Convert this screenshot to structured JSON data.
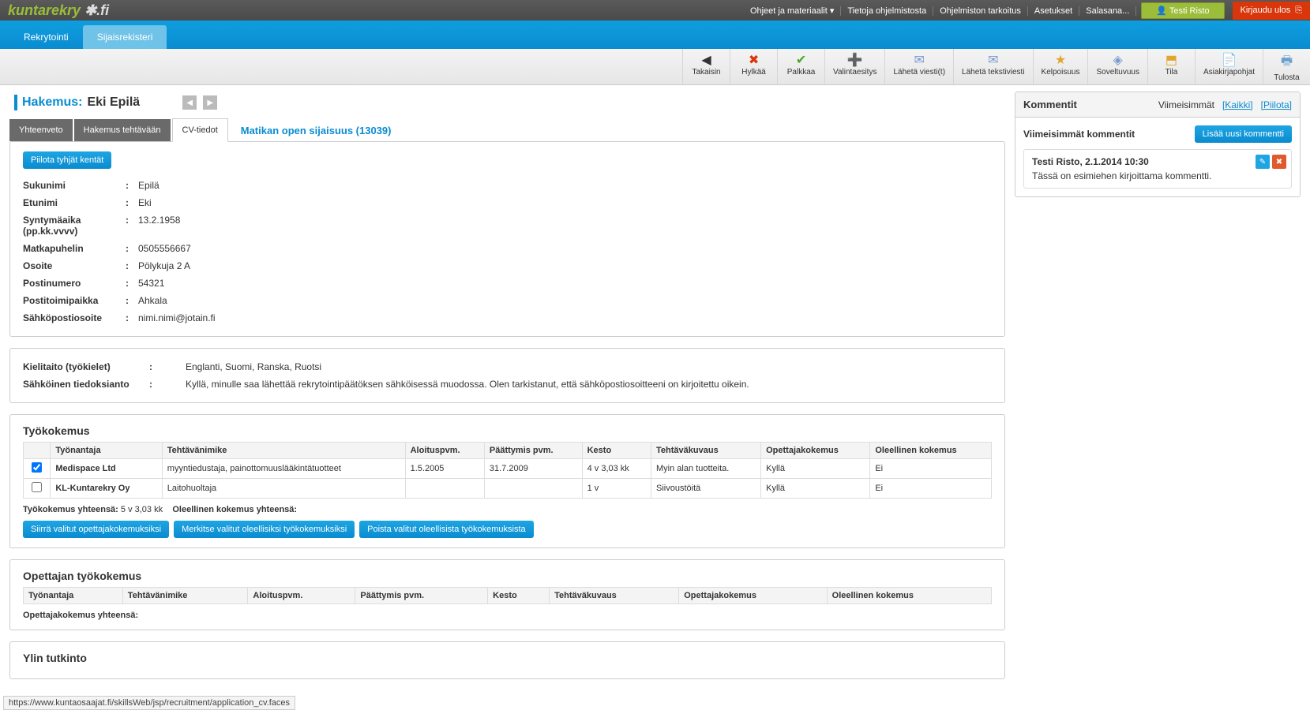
{
  "topbar": {
    "links": [
      "Ohjeet ja materiaalit ▾",
      "Tietoja ohjelmistosta",
      "Ohjelmiston tarkoitus",
      "Asetukset",
      "Salasana..."
    ],
    "user": "Testi Risto",
    "logout": "Kirjaudu ulos"
  },
  "nav": {
    "t1": "Rekrytointi",
    "t2": "Sijaisrekisteri"
  },
  "tools": [
    {
      "icon": "◀",
      "label": "Takaisin"
    },
    {
      "icon": "✖",
      "label": "Hylkää",
      "color": "#d9360b"
    },
    {
      "icon": "✔",
      "label": "Palkkaa",
      "color": "#4aa72a"
    },
    {
      "icon": "➕",
      "label": "Valintaesitys",
      "color": "#4aa72a"
    },
    {
      "icon": "✉",
      "label": "Lähetä viesti(t)",
      "color": "#7a9ad0"
    },
    {
      "icon": "✉",
      "label": "Lähetä tekstiviesti",
      "color": "#7a9ad0"
    },
    {
      "icon": "★",
      "label": "Kelpoisuus",
      "color": "#e0a62e"
    },
    {
      "icon": "◈",
      "label": "Soveltuvuus",
      "color": "#7a9ad0"
    },
    {
      "icon": "⬒",
      "label": "Tila",
      "color": "#e0a62e"
    },
    {
      "icon": "📄",
      "label": "Asiakirjapohjat",
      "color": "#7a9ad0"
    },
    {
      "icon": "🖶",
      "label": "Tulosta",
      "color": "#6aa0d0"
    }
  ],
  "heading": {
    "label": "Hakemus:",
    "value": "Eki Epilä"
  },
  "ctabs": {
    "t1": "Yhteenveto",
    "t2": "Hakemus tehtävään",
    "t3": "CV-tiedot",
    "link": "Matikan open sijaisuus (13039)"
  },
  "hideBtn": "Piilota tyhjät kentät",
  "personal": [
    {
      "k": "Sukunimi",
      "v": "Epilä"
    },
    {
      "k": "Etunimi",
      "v": "Eki"
    },
    {
      "k": "Syntymäaika (pp.kk.vvvv)",
      "v": "13.2.1958"
    },
    {
      "k": "Matkapuhelin",
      "v": "0505556667"
    },
    {
      "k": "Osoite",
      "v": "Pölykuja 2 A"
    },
    {
      "k": "Postinumero",
      "v": "54321"
    },
    {
      "k": "Postitoimipaikka",
      "v": "Ahkala"
    },
    {
      "k": "Sähköpostiosoite",
      "v": "nimi.nimi@jotain.fi"
    }
  ],
  "extra": [
    {
      "k": "Kielitaito (työkielet)",
      "v": "Englanti, Suomi, Ranska, Ruotsi"
    },
    {
      "k": "Sähköinen tiedoksianto",
      "v": "Kyllä, minulle saa lähettää rekrytointipäätöksen sähköisessä muodossa. Olen tarkistanut, että sähköpostiosoitteeni on kirjoitettu oikein."
    }
  ],
  "work": {
    "title": "Työkokemus",
    "headers": [
      "",
      "Työnantaja",
      "Tehtävänimike",
      "Aloituspvm.",
      "Päättymis pvm.",
      "Kesto",
      "Tehtäväkuvaus",
      "Opettajakokemus",
      "Oleellinen kokemus"
    ],
    "rows": [
      {
        "chk": true,
        "c": [
          "Medispace Ltd",
          "myyntiedustaja, painottomuuslääkintätuotteet",
          "1.5.2005",
          "31.7.2009",
          "4 v 3,03 kk",
          "Myin alan tuotteita.",
          "Kyllä",
          "Ei"
        ]
      },
      {
        "chk": false,
        "c": [
          "KL-Kuntarekry Oy",
          "Laitohuoltaja",
          "",
          "",
          "1 v",
          "Siivoustöitä",
          "Kyllä",
          "Ei"
        ]
      }
    ],
    "sum1_label": "Työkokemus yhteensä:",
    "sum1_val": "5 v 3,03 kk",
    "sum2_label": "Oleellinen kokemus yhteensä:",
    "b1": "Siirrä valitut opettajakokemuksiksi",
    "b2": "Merkitse valitut oleellisiksi työkokemuksiksi",
    "b3": "Poista valitut oleellisista työkokemuksista"
  },
  "teacher": {
    "title": "Opettajan työkokemus",
    "headers": [
      "Työnantaja",
      "Tehtävänimike",
      "Aloituspvm.",
      "Päättymis pvm.",
      "Kesto",
      "Tehtäväkuvaus",
      "Opettajakokemus",
      "Oleellinen kokemus"
    ],
    "sum": "Opettajakokemus yhteensä:"
  },
  "degree": {
    "title": "Ylin tutkinto"
  },
  "comments": {
    "title": "Kommentit",
    "recent": "Viimeisimmät",
    "all": "[Kaikki]",
    "hide": "[Piilota]",
    "subhead": "Viimeisimmät kommentit",
    "addbtn": "Lisää uusi kommentti",
    "c_meta": "Testi Risto, 2.1.2014 10:30",
    "c_text": "Tässä on esimiehen kirjoittama kommentti."
  },
  "status": "https://www.kuntaosaajat.fi/skillsWeb/jsp/recruitment/application_cv.faces"
}
